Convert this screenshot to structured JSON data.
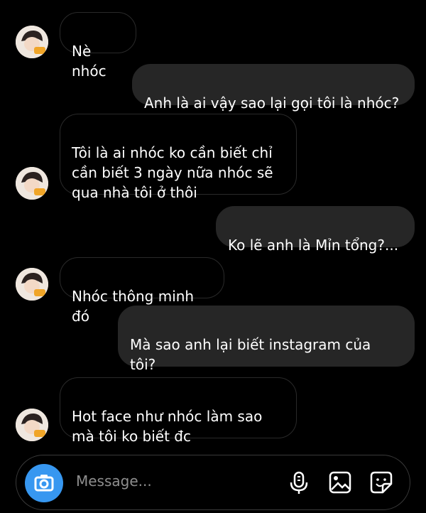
{
  "messages": [
    {
      "side": "in",
      "text": "Nè nhóc"
    },
    {
      "side": "out",
      "text": "Anh là ai vậy sao lại gọi tôi là nhóc?"
    },
    {
      "side": "in",
      "text": "Tôi là ai nhóc ko cần biết chỉ\ncần biết 3 ngày nữa nhóc sẽ\nqua nhà tôi ở thôi"
    },
    {
      "side": "out",
      "text": "Ko lẽ anh là Mỉn tổng?..."
    },
    {
      "side": "in",
      "text": "Nhóc thông minh đó"
    },
    {
      "side": "out",
      "text": "Mà sao anh lại biết instagram của\ntôi?"
    },
    {
      "side": "in",
      "text": "Hot face như nhóc làm sao\nmà tôi ko biết đc"
    }
  ],
  "composer": {
    "placeholder": "Message...",
    "icons": [
      "camera-icon",
      "microphone-icon",
      "gallery-icon",
      "sticker-icon"
    ]
  },
  "colors": {
    "background": "#000000",
    "outgoing_bubble": "#262626",
    "camera_button": "#3797f0"
  }
}
